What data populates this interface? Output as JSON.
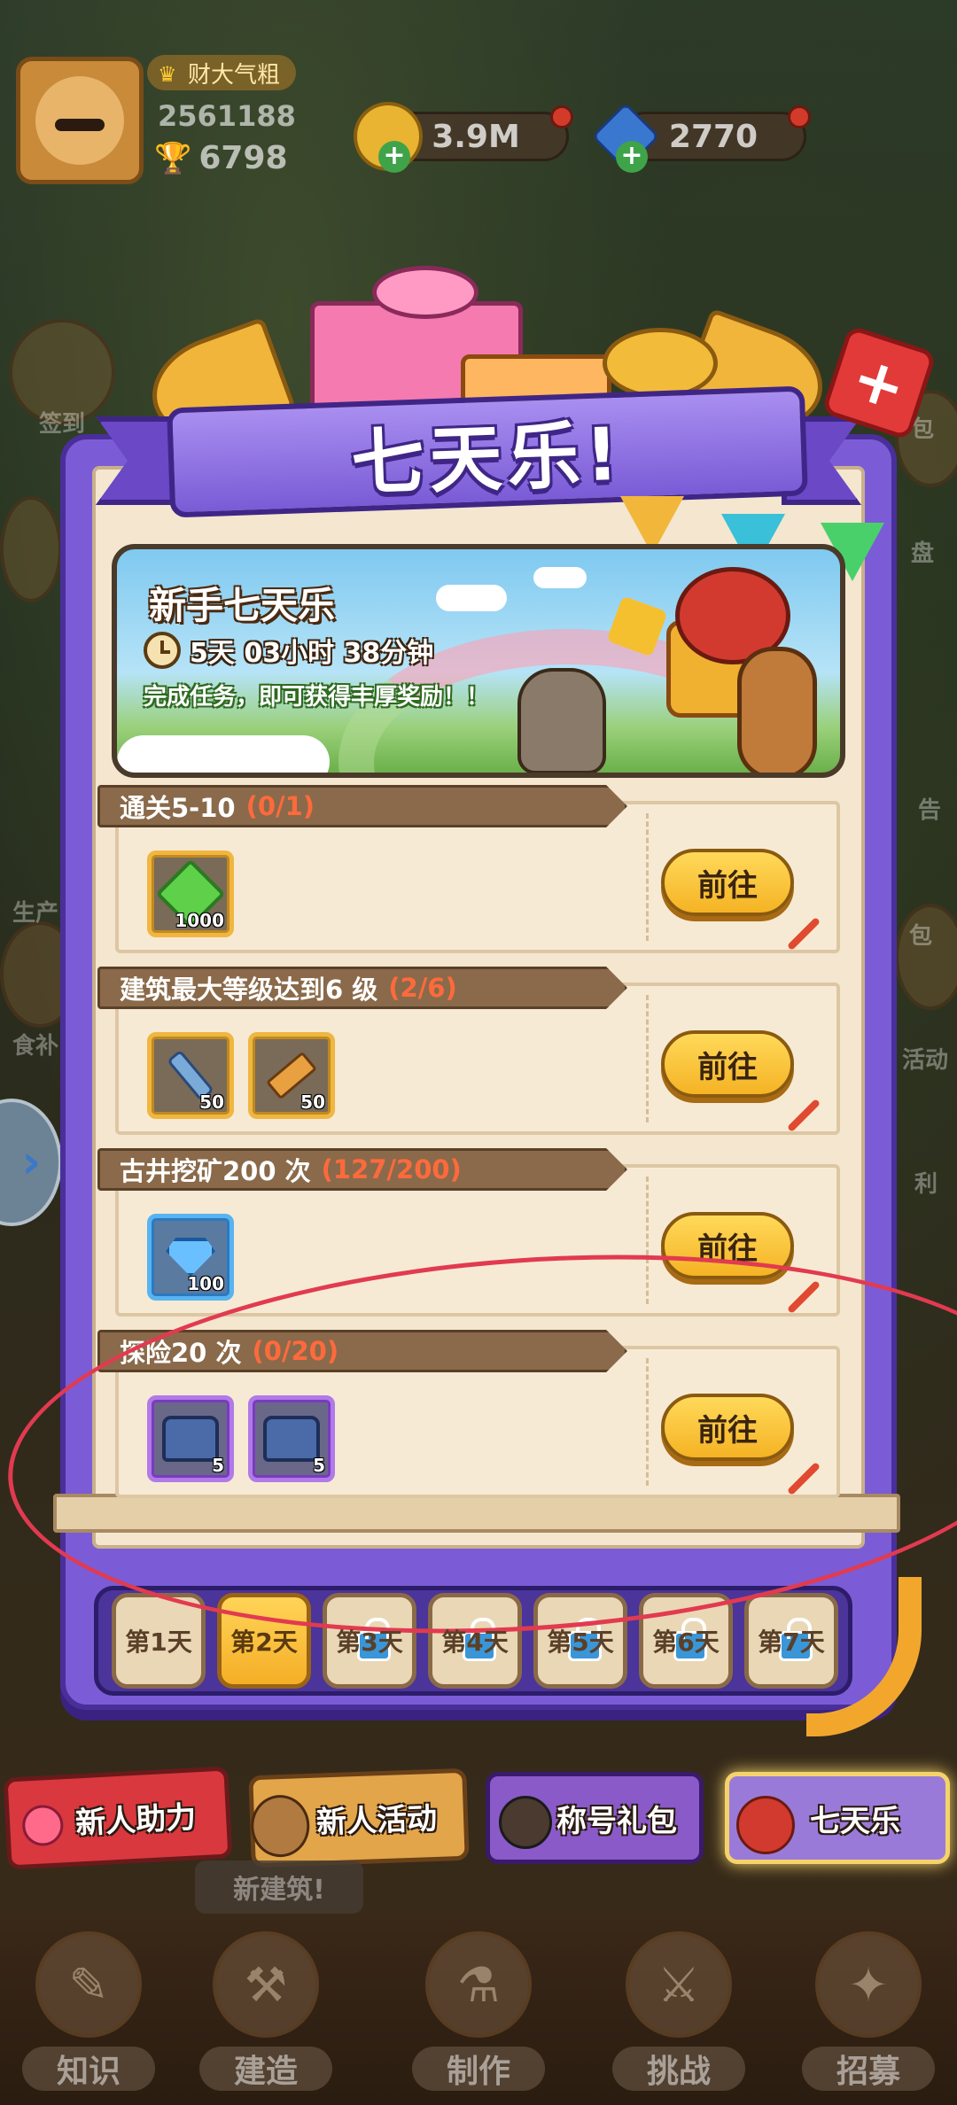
{
  "player": {
    "title": "财大气粗",
    "id": "2561188",
    "trophies": "6798"
  },
  "resources": {
    "gold": "3.9M",
    "gems": "2770"
  },
  "popup": {
    "banner_title": "七天乐!",
    "hero": {
      "title": "新手七天乐",
      "countdown": "5天 03小时 38分钟",
      "description": "完成任务，即可获得丰厚奖励！！"
    },
    "tasks": [
      {
        "name": "通关5-10",
        "progress": "(0/1)",
        "rewards": [
          {
            "icon": "green-gem-icon",
            "qty": "1000",
            "frame": "gold"
          }
        ],
        "button": "前往"
      },
      {
        "name": "建筑最大等级达到6 级",
        "progress": "(2/6)",
        "rewards": [
          {
            "icon": "screw-icon",
            "qty": "50",
            "frame": "gold"
          },
          {
            "icon": "hammer-icon",
            "qty": "50",
            "frame": "gold"
          }
        ],
        "button": "前往"
      },
      {
        "name": "古井挖矿200 次",
        "progress": "(127/200)",
        "rewards": [
          {
            "icon": "blue-diamond-icon",
            "qty": "100",
            "frame": "blue"
          }
        ],
        "button": "前往"
      },
      {
        "name": "探险20 次",
        "progress": "(0/20)",
        "rewards": [
          {
            "icon": "blue-chest-icon",
            "qty": "5",
            "frame": "purple"
          },
          {
            "icon": "blue-chest-icon",
            "qty": "5",
            "frame": "purple"
          }
        ],
        "button": "前往"
      }
    ],
    "days": [
      {
        "label": "第1天",
        "state": "done"
      },
      {
        "label": "第2天",
        "state": "active"
      },
      {
        "label": "第3天",
        "state": "locked"
      },
      {
        "label": "第4天",
        "state": "locked"
      },
      {
        "label": "第5天",
        "state": "locked"
      },
      {
        "label": "第6天",
        "state": "locked"
      },
      {
        "label": "第7天",
        "state": "locked"
      }
    ]
  },
  "promos": [
    {
      "label": "新人助力"
    },
    {
      "label": "新人活动"
    },
    {
      "label": "称号礼包"
    },
    {
      "label": "七天乐"
    }
  ],
  "nav": [
    {
      "label": "知识"
    },
    {
      "label": "建造"
    },
    {
      "label": "制作"
    },
    {
      "label": "挑战"
    },
    {
      "label": "招募"
    }
  ],
  "new_building_tag": "新建筑!",
  "side_labels": [
    "签到",
    "包",
    "盘",
    "生产",
    "食补",
    "包",
    "活动",
    "利",
    "告"
  ],
  "colors": {
    "panel_purple": "#7b5cd6",
    "panel_cream": "#f4e6cf",
    "button_yellow": "#f5b324",
    "progress_red": "#ff6a3c",
    "annotation_red": "#e23a50"
  }
}
